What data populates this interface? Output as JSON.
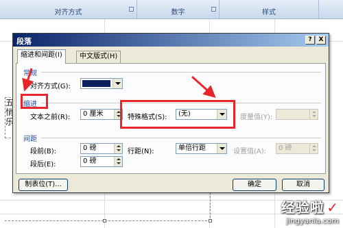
{
  "ribbon": {
    "groups": [
      "对齐方式",
      "数字",
      "样式"
    ]
  },
  "document": {
    "textbox_chars": [
      "五",
      "悄",
      "乐"
    ]
  },
  "dialog": {
    "title": "段落",
    "help_button": "?",
    "close_button": "X",
    "tabs": [
      "缩进和间距(I)",
      "中文版式(H)"
    ],
    "general": {
      "title": "常规",
      "align_label": "对齐方式(G):",
      "align_value": ""
    },
    "indent": {
      "title": "缩进",
      "before_text_label": "文本之前(R):",
      "before_text_value": "0 厘米",
      "special_label": "特殊格式(S):",
      "special_value": "(无)",
      "measure_label": "度量值(Y):",
      "measure_value": ""
    },
    "spacing": {
      "title": "间距",
      "before_label": "段前(B):",
      "before_value": "0 磅",
      "after_label": "段后(E):",
      "after_value": "0 磅",
      "line_label": "行距(N):",
      "line_value": "单倍行距",
      "setvalue_label": "设置值(A):",
      "setvalue_value": "0 磅"
    },
    "buttons": {
      "tabs": "制表位(T)...",
      "ok": "确定",
      "cancel": "取消"
    }
  },
  "watermark": {
    "name": "经验啦",
    "check": "✓",
    "url": "jingyanla.com"
  },
  "colors": {
    "annotation_red": "#e8262a",
    "title_bar": "#0a246a",
    "align_swatch": "#0a1f5c"
  }
}
